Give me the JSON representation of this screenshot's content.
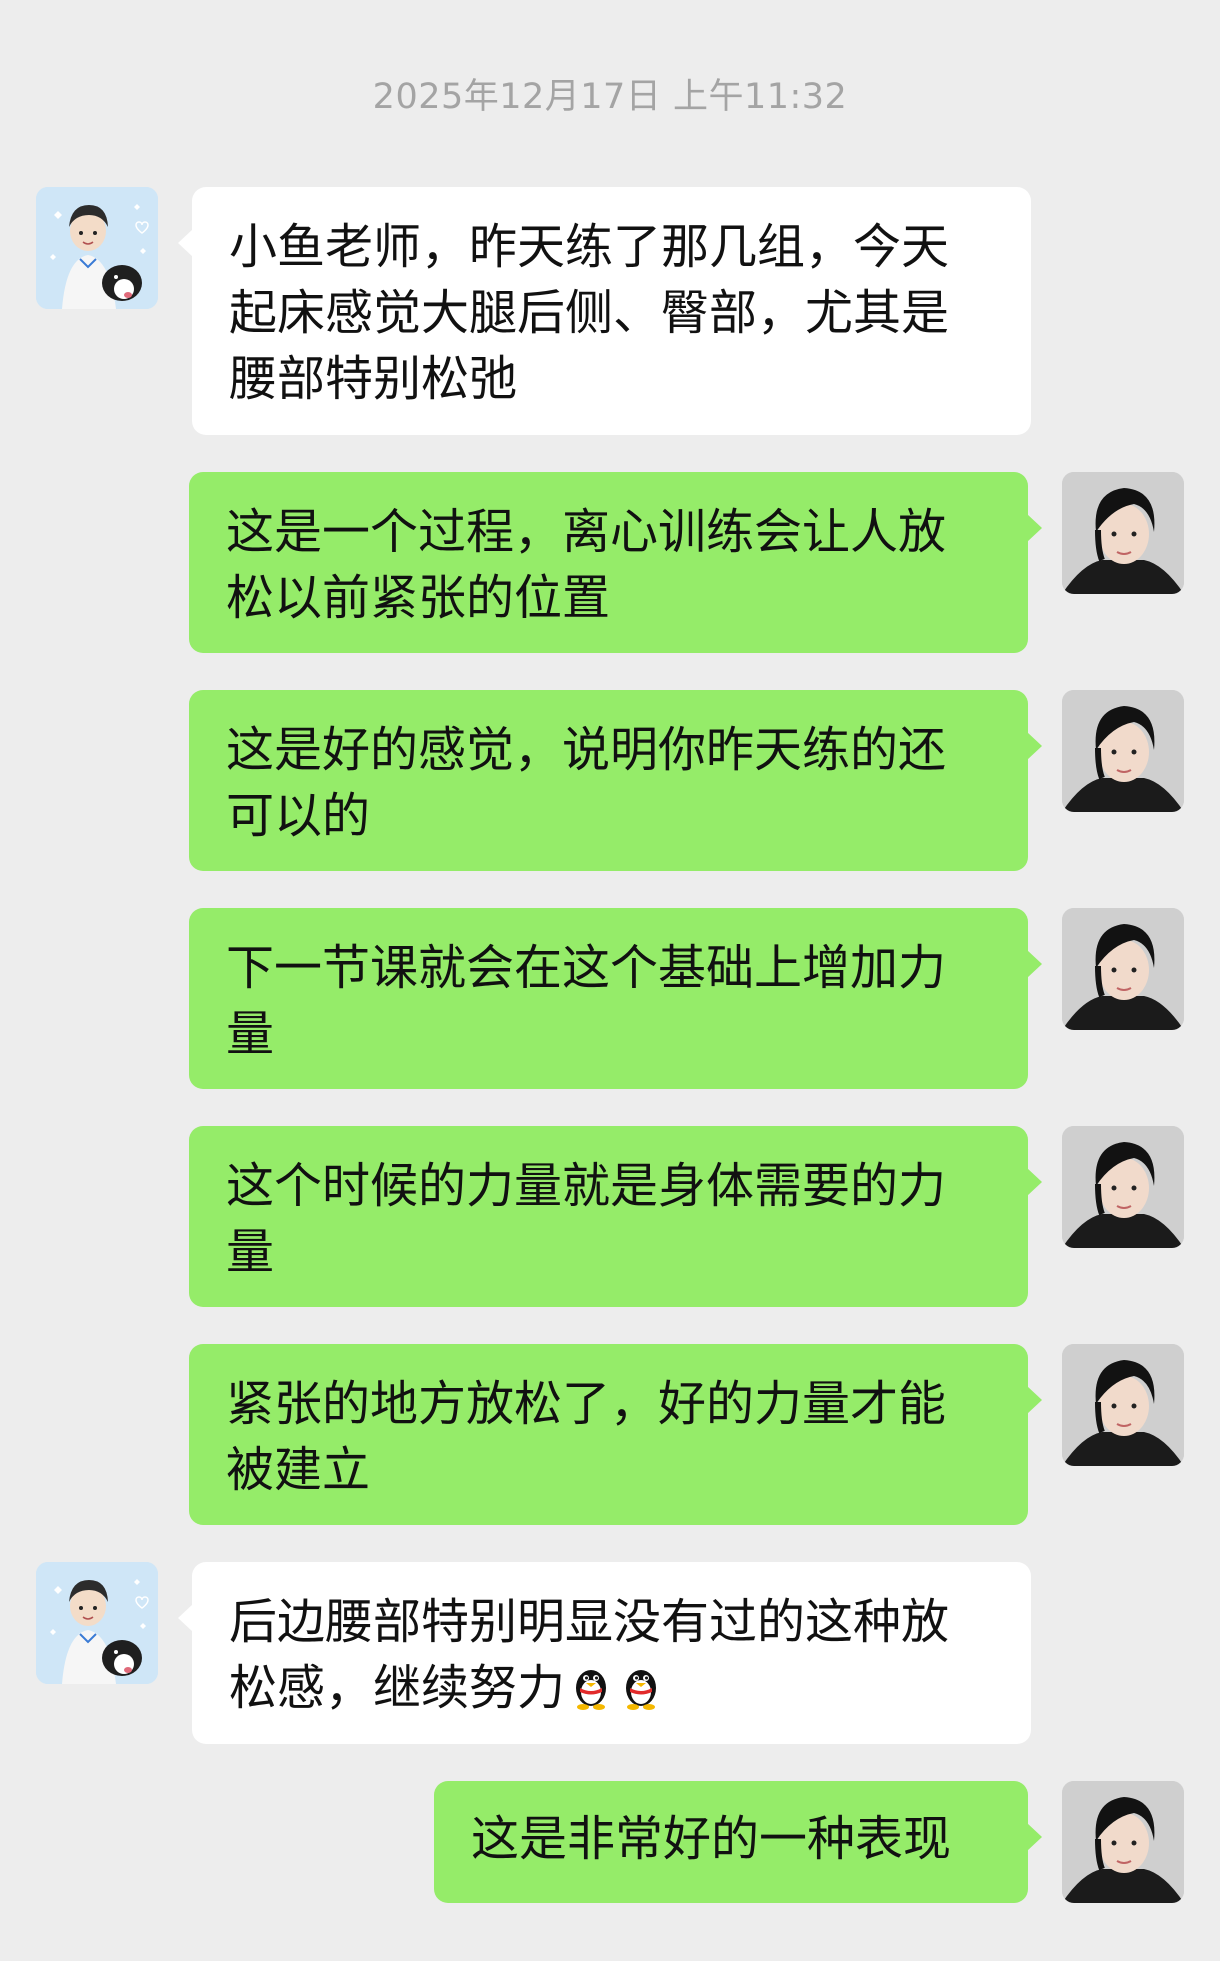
{
  "chat": {
    "timestamp": "2025年12月17日 上午11:32",
    "messages": [
      {
        "side": "left",
        "text": "小鱼老师，昨天练了那几组，今天起床感觉大腿后侧、臀部，尤其是腰部特别松弛"
      },
      {
        "side": "right",
        "text": "这是一个过程，离心训练会让人放松以前紧张的位置"
      },
      {
        "side": "right",
        "text": "这是好的感觉，说明你昨天练的还可以的"
      },
      {
        "side": "right",
        "text": "下一节课就会在这个基础上增加力量"
      },
      {
        "side": "right",
        "text": "这个时候的力量就是身体需要的力量"
      },
      {
        "side": "right",
        "text": "紧张的地方放松了，好的力量才能被建立"
      },
      {
        "side": "left",
        "text": "后边腰部特别明显没有过的这种放松感，继续努力",
        "emojis": [
          "penguin-emoji",
          "penguin-emoji"
        ]
      },
      {
        "side": "right",
        "text": "这是非常好的一种表现"
      }
    ]
  },
  "colors": {
    "background": "#ededed",
    "incoming_bubble": "#ffffff",
    "outgoing_bubble": "#95ec69",
    "timestamp_text": "#a4a4a4"
  }
}
